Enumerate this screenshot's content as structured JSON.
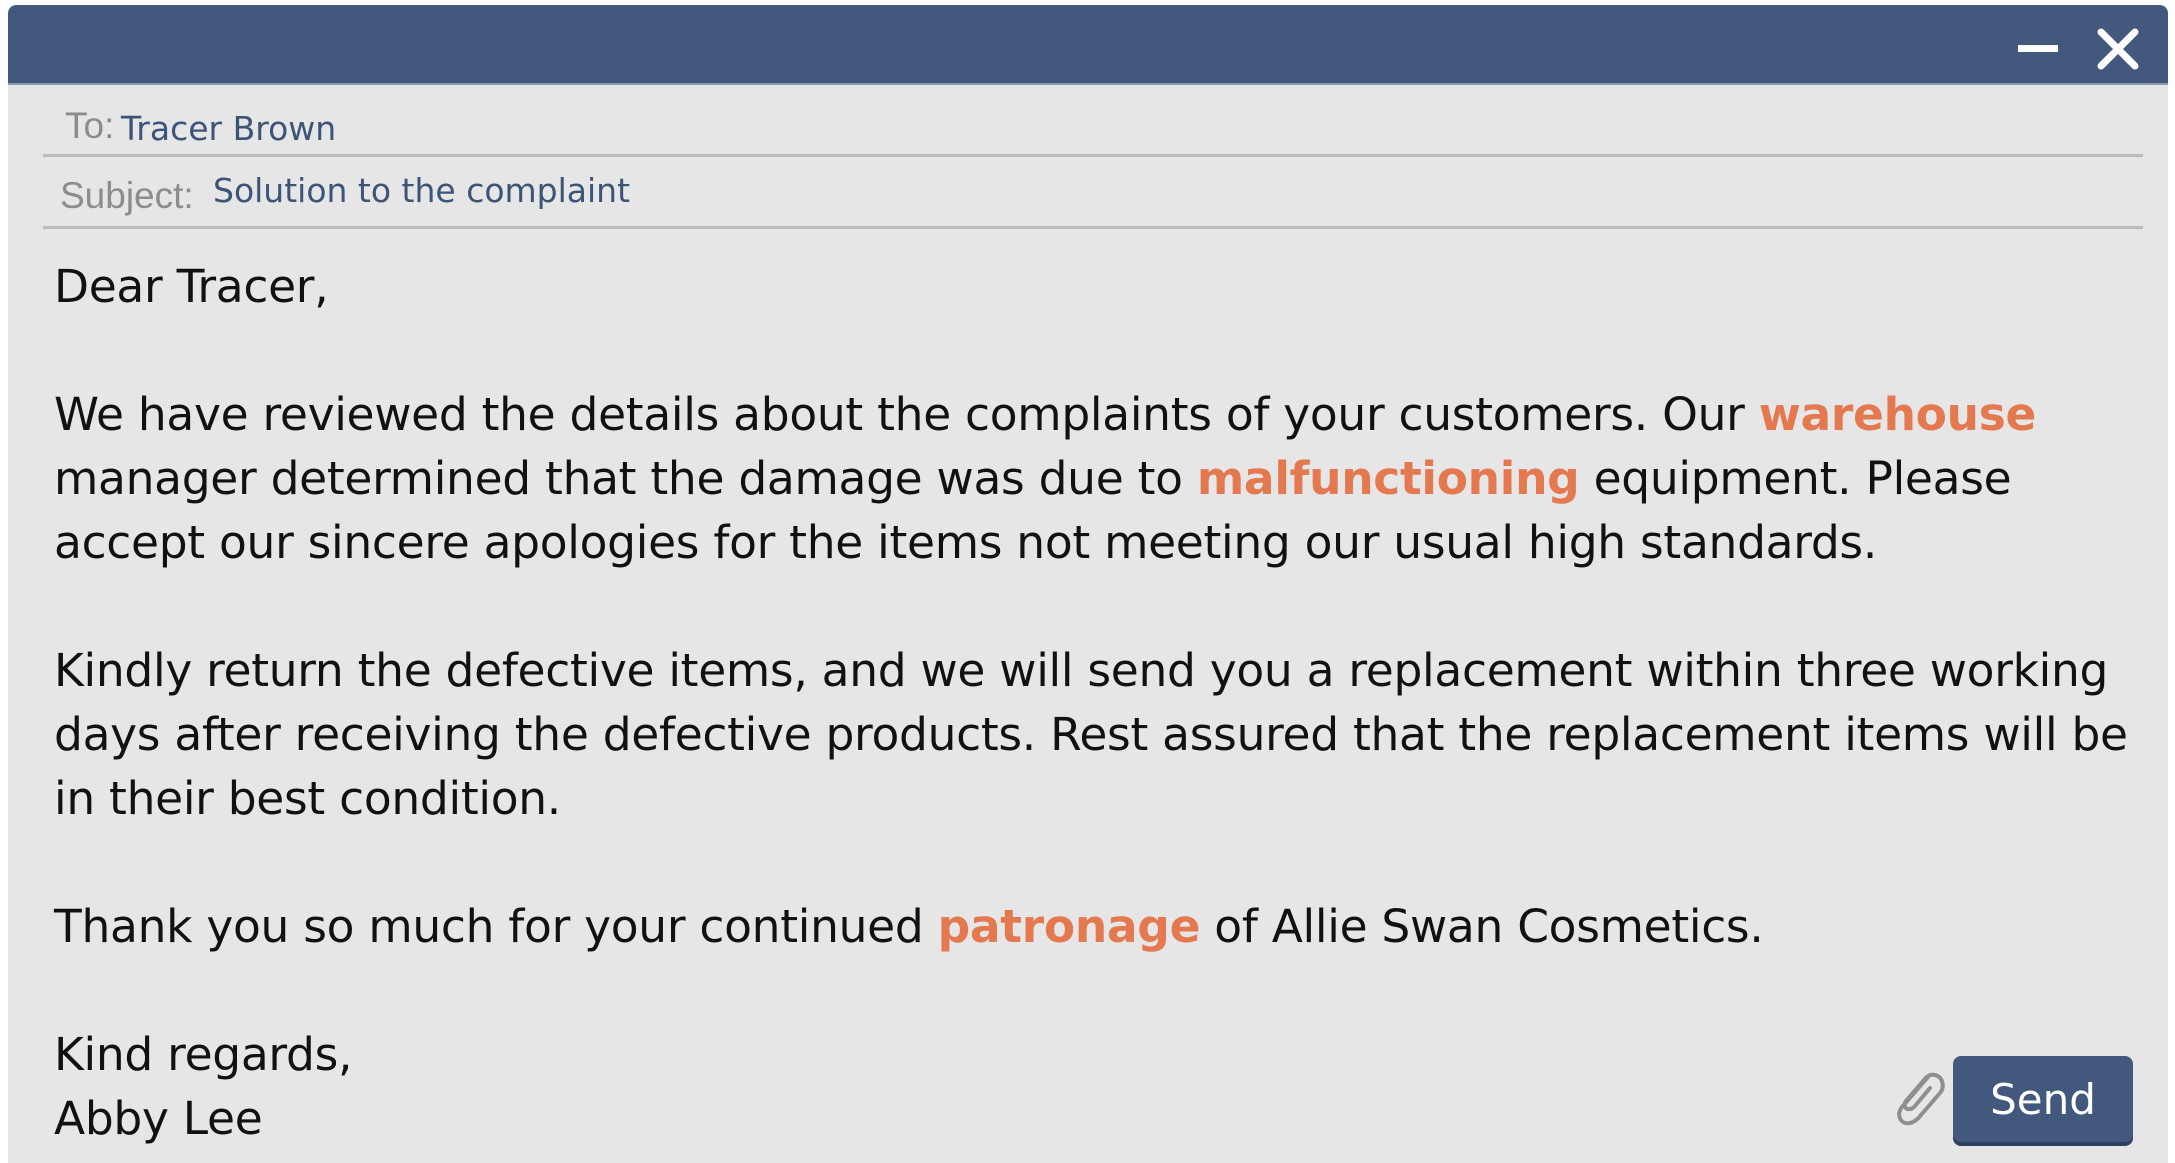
{
  "window": {
    "minimize_icon": "minimize-icon",
    "close_icon": "close-icon",
    "titlebar_color": "#42597d"
  },
  "header": {
    "to_label": "To:",
    "to_value": "Tracer Brown",
    "subject_label": "Subject:",
    "subject_value": "Solution to the complaint"
  },
  "body": {
    "greeting": "Dear Tracer,",
    "p1": {
      "a": "We have reviewed the details about the complaints of your customers. Our ",
      "k1": "warehouse",
      "b": " manager determined that the damage was due to ",
      "k2": "malfunctioning",
      "c": " equipment. Please accept our sincere apologies for the items not meeting our usual high standards."
    },
    "p2": "Kindly return the defective items, and we will send you a replacement within three working days after receiving the defective products. Rest assured that the replacement items will be in their best condition.",
    "p3": {
      "a": "Thank you so much for your continued ",
      "k1": "patronage",
      "b": " of Allie Swan Cosmetics."
    },
    "closing": "Kind regards,",
    "signature": "Abby Lee",
    "keyword_color": "#e4784f"
  },
  "footer": {
    "attach_icon": "paperclip-icon",
    "send_label": "Send"
  }
}
